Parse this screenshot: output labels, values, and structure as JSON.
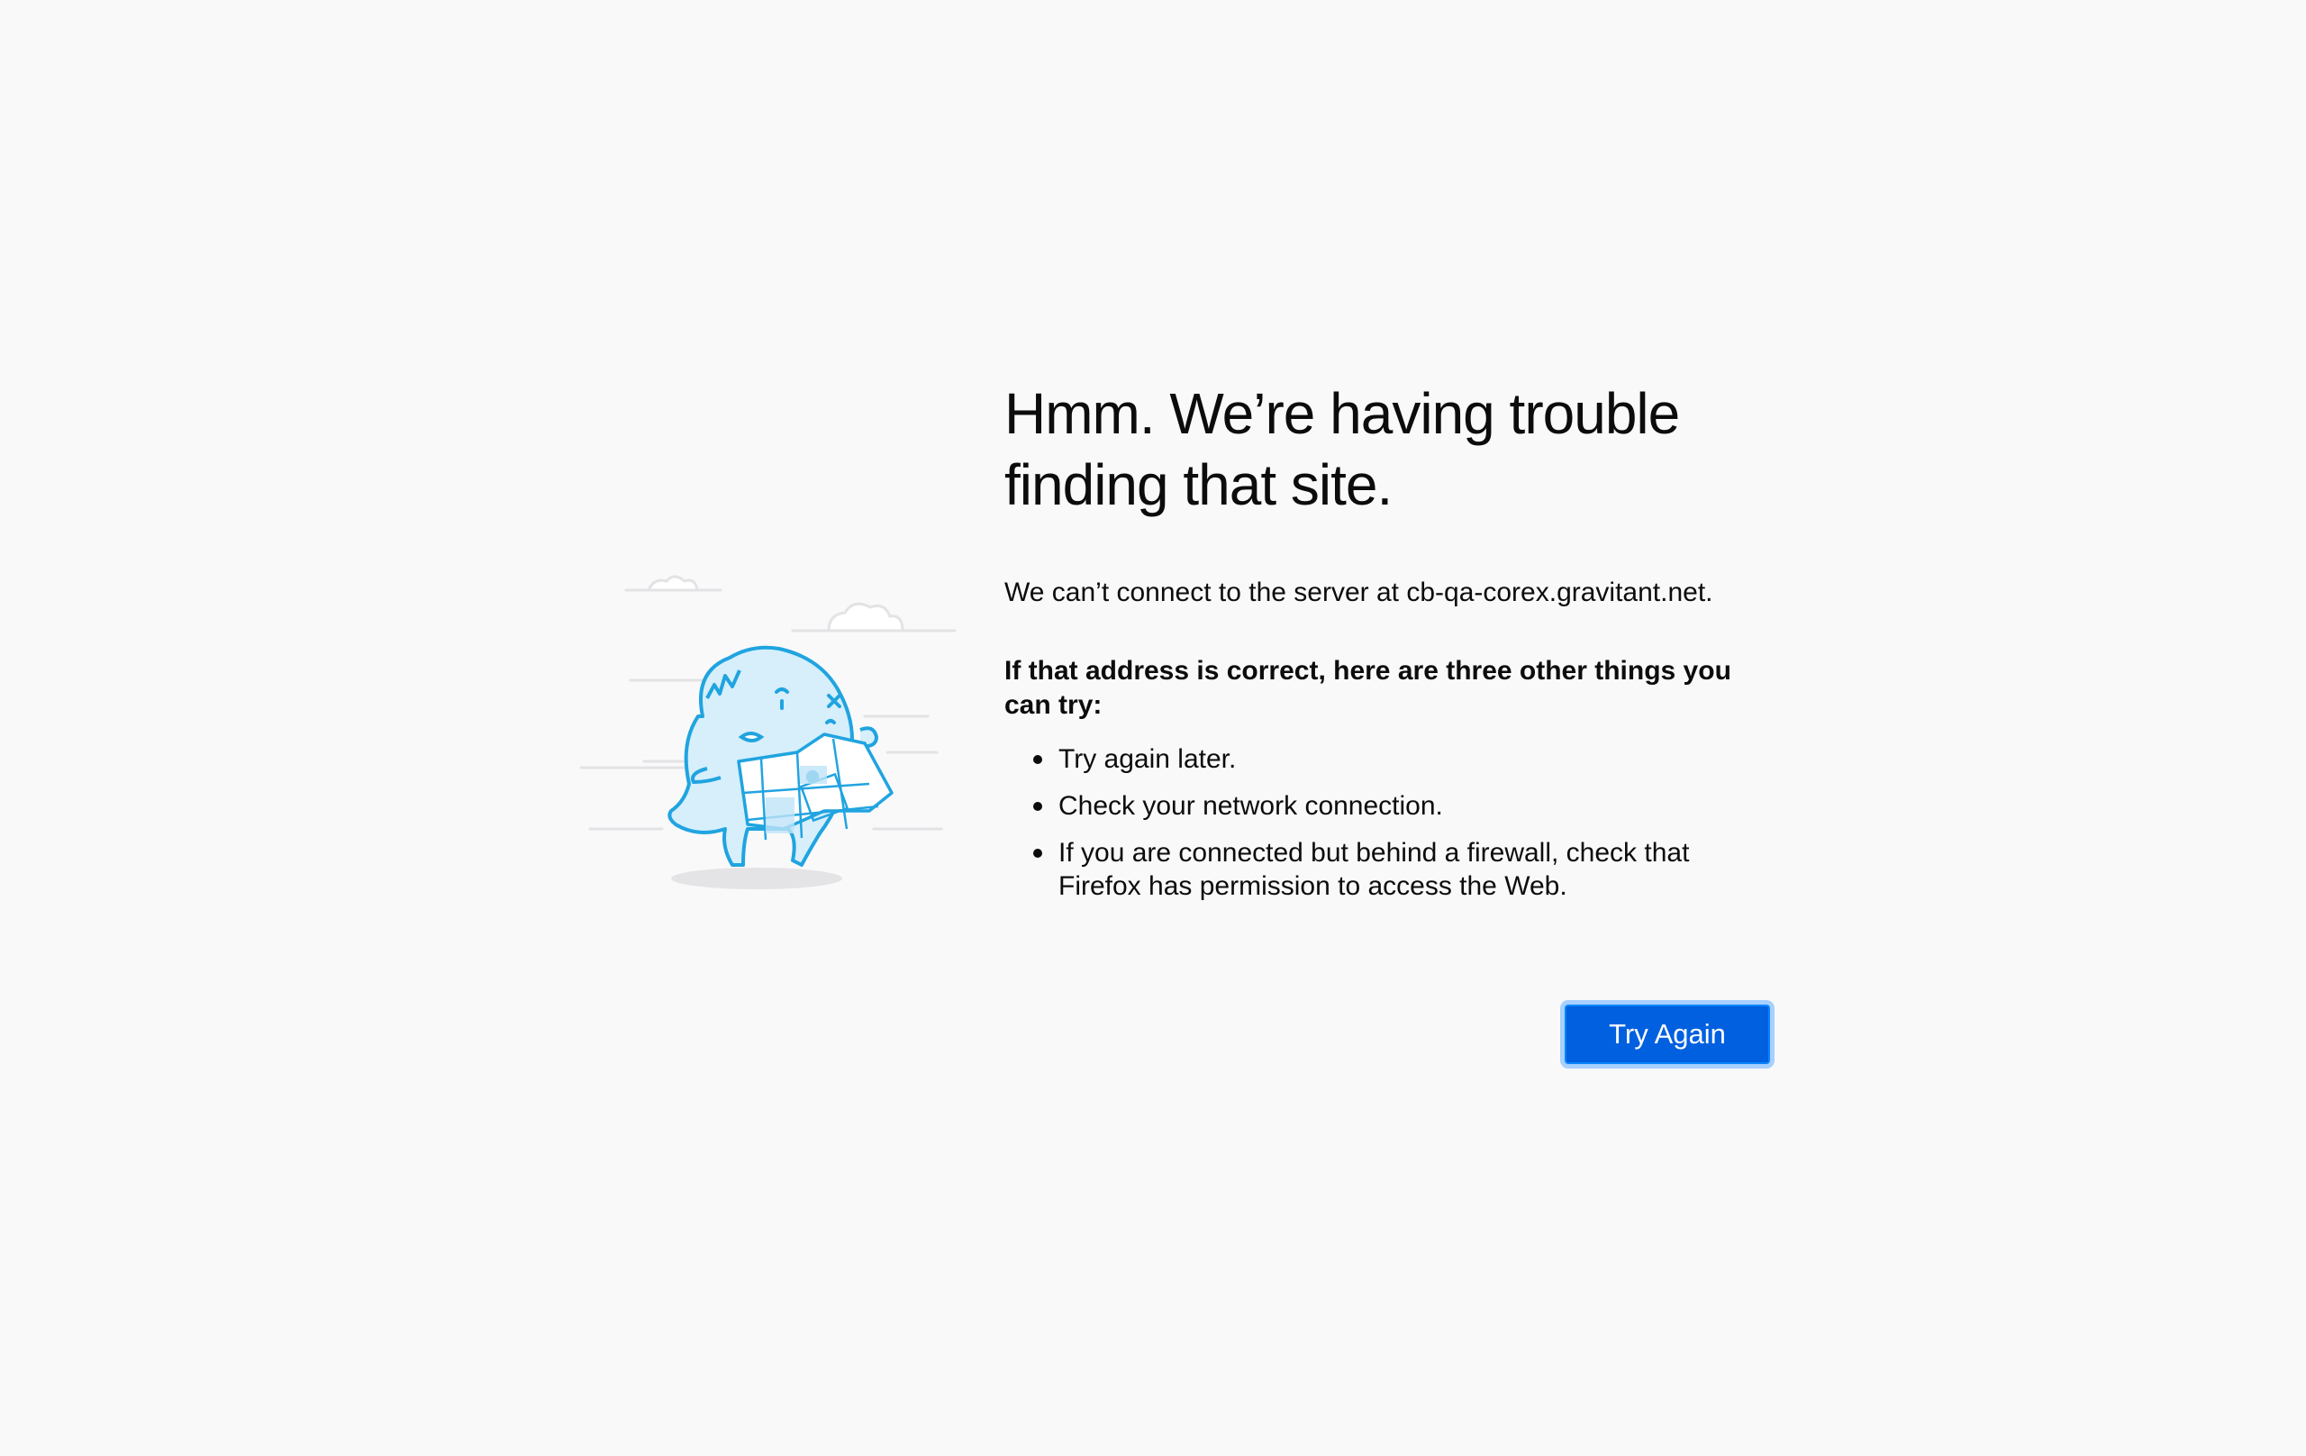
{
  "error": {
    "title": "Hmm. We’re having trouble finding that site.",
    "short_description": "We can’t connect to the server at cb-qa-corex.gravitant.net.",
    "try_heading": "If that address is correct, here are three other things you can try:",
    "suggestions": [
      "Try again later.",
      "Check your network connection.",
      "If you are connected but behind a firewall, check that Firefox has permission to access the Web."
    ],
    "try_again_label": "Try Again"
  },
  "colors": {
    "background": "#f9f9fa",
    "button": "#0060df",
    "button_focus_ring": "#a8d0ff",
    "illustration_stroke": "#20a4e0",
    "illustration_fill": "#d6effb"
  },
  "icons": {
    "illustration": "lost-monster-with-map-illustration"
  }
}
